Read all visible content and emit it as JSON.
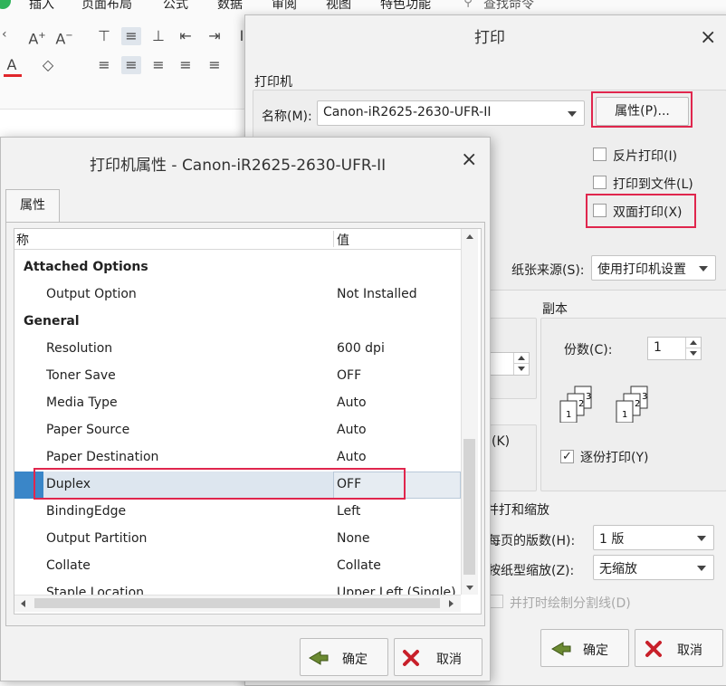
{
  "ribbon": {
    "menu": [
      "插入",
      "页面布局",
      "公式",
      "数据",
      "审阅",
      "视图",
      "特色功能"
    ],
    "search_placeholder": "查找命令",
    "icons": [
      "font-grow-icon",
      "font-shrink-icon",
      "font-color-icon",
      "eraser-icon",
      "align-top-icon",
      "align-middle-icon",
      "align-bottom-icon",
      "indent-decrease-icon",
      "indent-increase-icon",
      "align-left-icon",
      "align-center-icon",
      "align-right-icon",
      "justify-icon",
      "distributed-icon"
    ]
  },
  "print_dialog": {
    "title": "打印",
    "printer_group_label": "打印机",
    "name_label": "名称(M):",
    "printer_name": "Canon-iR2625-2630-UFR-II",
    "properties_button": "属性(P)...",
    "reverse_print": "反片打印(I)",
    "print_to_file": "打印到文件(L)",
    "duplex_print": "双面打印(X)",
    "paper_source_label": "纸张来源(S):",
    "paper_source_value": "使用打印机设置",
    "copies_group": "副本",
    "copies_label": "份数(C):",
    "copies_value": "1",
    "collate_label": "逐份打印(Y)",
    "collate_checked": true,
    "partial_k": "(K)",
    "zoom_group": "并打和缩放",
    "pages_per_sheet_label": "每页的版数(H):",
    "pages_per_sheet_value": "1 版",
    "scale_label": "按纸型缩放(Z):",
    "scale_value": "无缩放",
    "draw_divider": "并打时绘制分割线(D)",
    "ok_button": "确定",
    "cancel_button": "取消"
  },
  "props_dialog": {
    "title": "打印机属性 - Canon-iR2625-2630-UFR-II",
    "tab_label": "属性",
    "col_name": "称",
    "col_value": "值",
    "rows": [
      {
        "name": "Attached Options",
        "value": "",
        "category": true
      },
      {
        "name": "Output Option",
        "value": "Not Installed",
        "category": false
      },
      {
        "name": "General",
        "value": "",
        "category": true
      },
      {
        "name": "Resolution",
        "value": "600 dpi",
        "category": false
      },
      {
        "name": "Toner Save",
        "value": "OFF",
        "category": false
      },
      {
        "name": "Media Type",
        "value": "Auto",
        "category": false
      },
      {
        "name": "Paper Source",
        "value": "Auto",
        "category": false
      },
      {
        "name": "Paper Destination",
        "value": "Auto",
        "category": false
      },
      {
        "name": "Duplex",
        "value": "OFF",
        "category": false,
        "selected": true
      },
      {
        "name": "BindingEdge",
        "value": "Left",
        "category": false
      },
      {
        "name": "Output Partition",
        "value": "None",
        "category": false
      },
      {
        "name": "Collate",
        "value": "Collate",
        "category": false
      },
      {
        "name": "Staple Location",
        "value": "Upper Left (Single)",
        "category": false
      }
    ],
    "ok_button": "确定",
    "cancel_button": "取消"
  },
  "colors": {
    "highlight_red": "#e0264d",
    "selection_blue": "#3a86c8",
    "ok_icon_green": "#5a7a2a",
    "cancel_icon_red": "#c8202a"
  }
}
